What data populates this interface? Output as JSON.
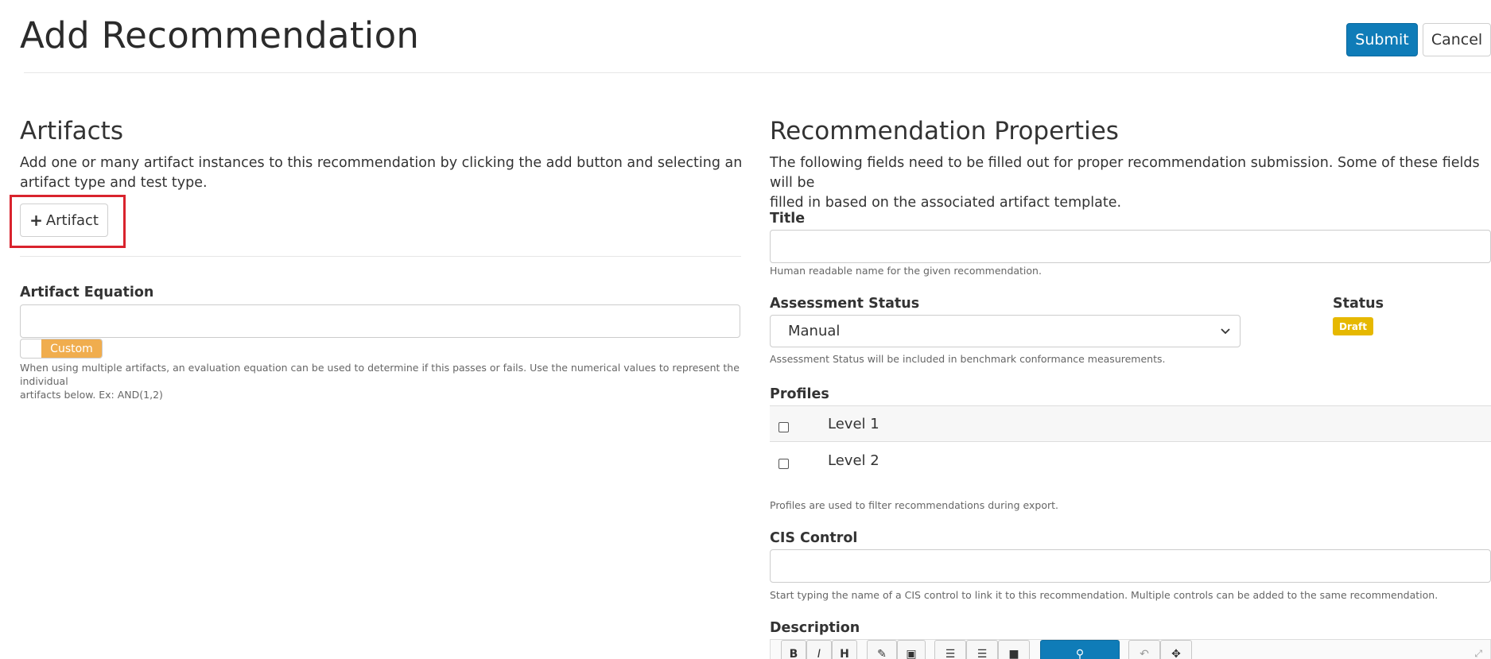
{
  "header": {
    "title": "Add Recommendation",
    "submit_label": "Submit",
    "cancel_label": "Cancel"
  },
  "artifacts": {
    "heading": "Artifacts",
    "description_line1": "Add one or many artifact instances to this recommendation by clicking the add button and selecting an",
    "description_line2": "artifact type and test type.",
    "add_button_icon": "plus-icon",
    "add_button_label": "Artifact",
    "equation_label": "Artifact Equation",
    "equation_value": "",
    "custom_toggle_label": "Custom",
    "equation_help_line1": "When using multiple artifacts, an evaluation equation can be used to determine if this passes or fails. Use the numerical values to represent the individual",
    "equation_help_line2": "artifacts below. Ex: AND(1,2)"
  },
  "properties": {
    "heading": "Recommendation Properties",
    "description_line1": "The following fields need to be filled out for proper recommendation submission. Some of these fields will be",
    "description_line2": "filled in based on the associated artifact template.",
    "title_label": "Title",
    "title_value": "",
    "title_help": "Human readable name for the given recommendation.",
    "assessment_status_label": "Assessment Status",
    "assessment_status_value": "Manual",
    "assessment_status_help": "Assessment Status will be included in benchmark conformance measurements.",
    "status_label": "Status",
    "status_badge": "Draft",
    "profiles_label": "Profiles",
    "profiles": [
      {
        "label": "Level 1",
        "checked": false
      },
      {
        "label": "Level 2",
        "checked": false
      }
    ],
    "profiles_help": "Profiles are used to filter recommendations during export.",
    "cis_control_label": "CIS Control",
    "cis_control_value": "",
    "cis_control_help": "Start typing the name of a CIS control to link it to this recommendation. Multiple controls can be added to the same recommendation.",
    "description_label": "Description",
    "editor_tools": [
      "bold-icon",
      "italic-icon",
      "heading-icon",
      "eraser-icon",
      "image-icon",
      "unordered-list-icon",
      "ordered-list-icon",
      "table-icon",
      "preview-button",
      "undo-icon",
      "redo-icon",
      "fullscreen-icon"
    ]
  },
  "colors": {
    "primary": "#0f7cb8",
    "highlight": "#d9232d",
    "custom_toggle": "#f0ad4e",
    "draft_badge": "#e6b800"
  }
}
